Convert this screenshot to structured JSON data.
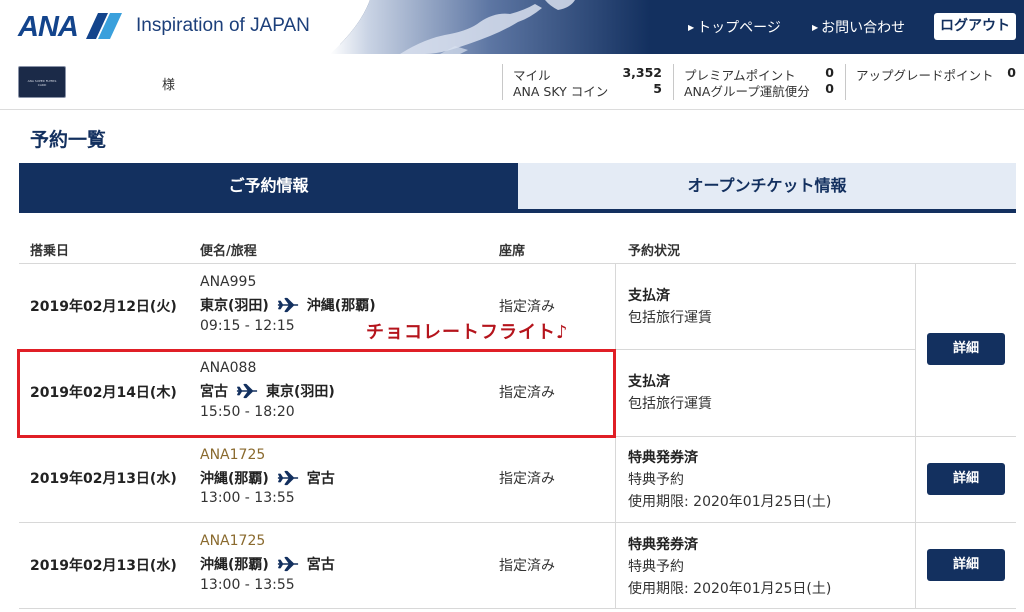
{
  "header": {
    "logo_text": "ANA",
    "tagline": "Inspiration of JAPAN",
    "nav": [
      {
        "label": "トップページ"
      },
      {
        "label": "お問い合わせ"
      }
    ],
    "logout_label": "ログアウト"
  },
  "member": {
    "card_text": "ANA SUPER FLYERS CARD",
    "honorific": "様",
    "miles_label": "マイル",
    "miles_value": "3,352",
    "sky_coin_label": "ANA SKY コイン",
    "sky_coin_value": "5",
    "premium_points_label": "プレミアムポイント",
    "premium_points_value": "0",
    "group_flights_label": "ANAグループ運航便分",
    "group_flights_value": "0",
    "upgrade_points_label": "アップグレードポイント",
    "upgrade_points_value": "0"
  },
  "page": {
    "title": "予約一覧"
  },
  "tabs": [
    {
      "label": "ご予約情報",
      "active": true
    },
    {
      "label": "オープンチケット情報",
      "active": false
    }
  ],
  "table": {
    "headers": [
      "搭乗日",
      "便名/旅程",
      "座席",
      "予約状況"
    ],
    "rows": [
      {
        "date": "2019年02月12日(火)",
        "flight": "ANA995",
        "from": "東京(羽田)",
        "to": "沖縄(那覇)",
        "time": "09:15 - 12:15",
        "seat": "指定済み",
        "status": "支払済",
        "fare": "包括旅行運賃"
      },
      {
        "date": "2019年02月14日(木)",
        "flight": "ANA088",
        "from": "宮古",
        "to": "東京(羽田)",
        "time": "15:50 - 18:20",
        "seat": "指定済み",
        "status": "支払済",
        "fare": "包括旅行運賃"
      },
      {
        "date": "2019年02月13日(水)",
        "flight": "ANA1725",
        "from": "沖縄(那覇)",
        "to": "宮古",
        "time": "13:00 - 13:55",
        "seat": "指定済み",
        "status": "特典発券済",
        "fare": "特典予約",
        "expiry": "使用期限: 2020年01月25日(土)"
      },
      {
        "date": "2019年02月13日(水)",
        "flight": "ANA1725",
        "from": "沖縄(那覇)",
        "to": "宮古",
        "time": "13:00 - 13:55",
        "seat": "指定済み",
        "status": "特典発券済",
        "fare": "特典予約",
        "expiry": "使用期限: 2020年01月25日(土)"
      }
    ],
    "detail_label": "詳細"
  },
  "annotation": {
    "text": "チョコレートフライト♪"
  },
  "colors": {
    "navy": "#13305f",
    "tab_inactive_bg": "#e4ebf5",
    "highlight_red": "#e01f26",
    "annotation_red": "#b5141c",
    "award_flight_gold": "#8a6a2e"
  }
}
